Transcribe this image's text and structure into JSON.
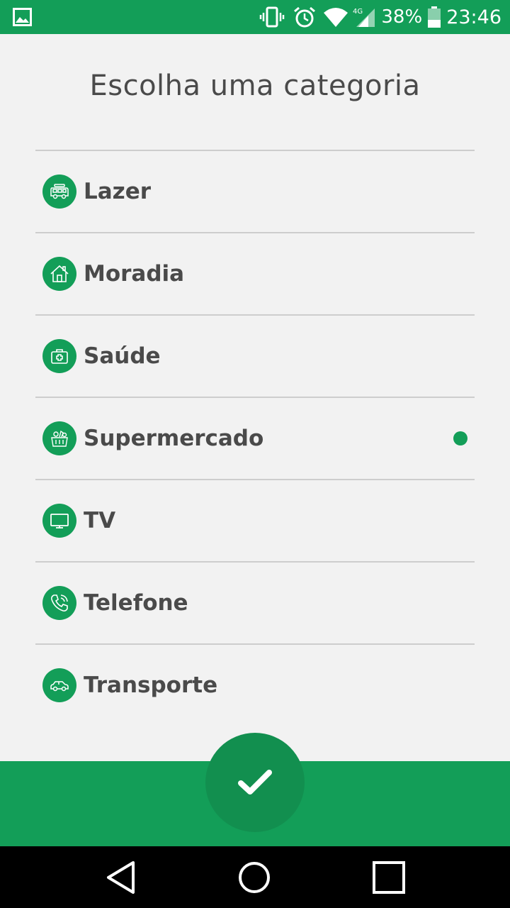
{
  "status_bar": {
    "battery_percent": "38%",
    "time": "23:46",
    "network": "4G",
    "icons": [
      "gallery-icon",
      "vibrate-icon",
      "alarm-icon",
      "wifi-icon",
      "cell-signal-icon",
      "battery-icon"
    ]
  },
  "page": {
    "title": "Escolha uma categoria"
  },
  "categories": [
    {
      "label": "Lazer",
      "icon": "van-icon",
      "selected": false
    },
    {
      "label": "Moradia",
      "icon": "house-icon",
      "selected": false
    },
    {
      "label": "Saúde",
      "icon": "first-aid-kit-icon",
      "selected": false
    },
    {
      "label": "Supermercado",
      "icon": "grocery-basket-icon",
      "selected": true
    },
    {
      "label": "TV",
      "icon": "tv-icon",
      "selected": false
    },
    {
      "label": "Telefone",
      "icon": "phone-icon",
      "selected": false
    },
    {
      "label": "Transporte",
      "icon": "car-icon",
      "selected": false
    }
  ],
  "colors": {
    "accent": "#139e58",
    "text": "#4a4a4a",
    "background": "#f2f2f2"
  },
  "actions": {
    "confirm_icon": "checkmark-icon"
  },
  "nav": {
    "icons": [
      "back-icon",
      "home-icon",
      "recents-icon"
    ]
  }
}
